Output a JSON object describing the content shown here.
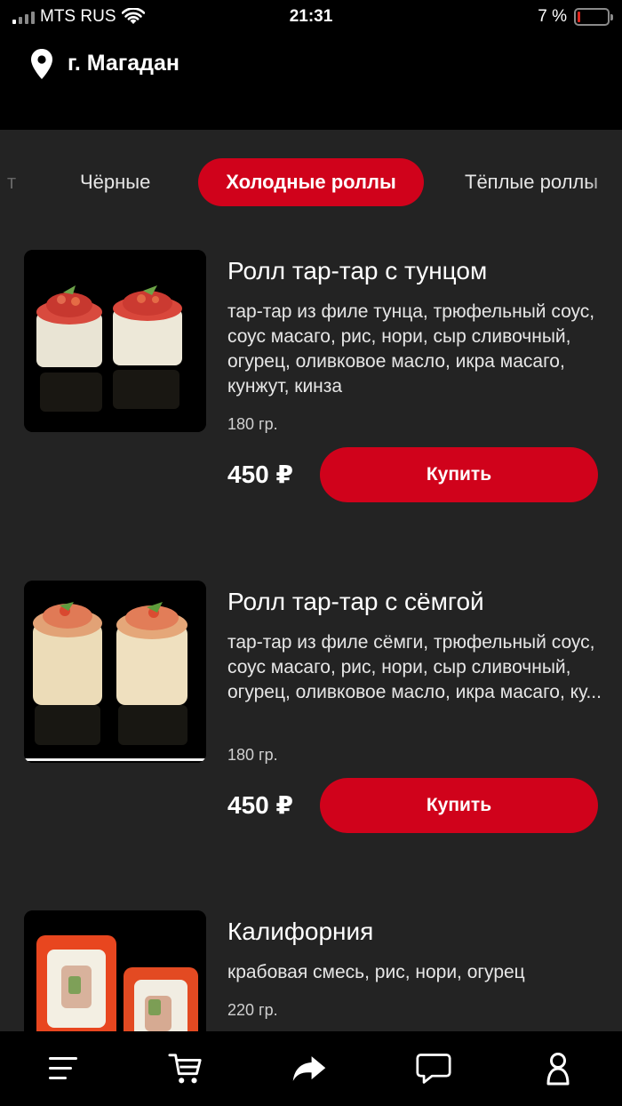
{
  "status_bar": {
    "carrier": "MTS RUS",
    "time": "21:31",
    "battery_percent": "7 %"
  },
  "location": {
    "city": "г. Магадан"
  },
  "categories": {
    "prev_partial": "т",
    "black": "Чёрные",
    "active": "Холодные роллы",
    "warm": "Тёплые роллы"
  },
  "products": [
    {
      "name": "Ролл тар-тар с тунцом",
      "description": "тар-тар из филе тунца, трюфельный соус, соус масаго, рис, нори, сыр сливочный, огурец, оливковое масло, икра масаго, кунжут, кинза",
      "weight": "180 гр.",
      "price": "450 ₽",
      "buy_label": "Купить"
    },
    {
      "name": "Ролл тар-тар с сёмгой",
      "description": "тар-тар из филе сёмги, трюфельный соус, соус масаго, рис, нори, сыр сливочный, огурец, оливковое масло, икра масаго, ку...",
      "weight": "180 гр.",
      "price": "450 ₽",
      "buy_label": "Купить"
    },
    {
      "name": "Калифорния",
      "description": "крабовая смесь, рис, нори, огурец",
      "weight": "220 гр."
    }
  ],
  "colors": {
    "accent": "#d0021b",
    "background": "#232323",
    "bar": "#000000"
  },
  "bottom_nav": [
    "menu-icon",
    "cart-icon",
    "share-icon",
    "chat-icon",
    "profile-icon"
  ]
}
